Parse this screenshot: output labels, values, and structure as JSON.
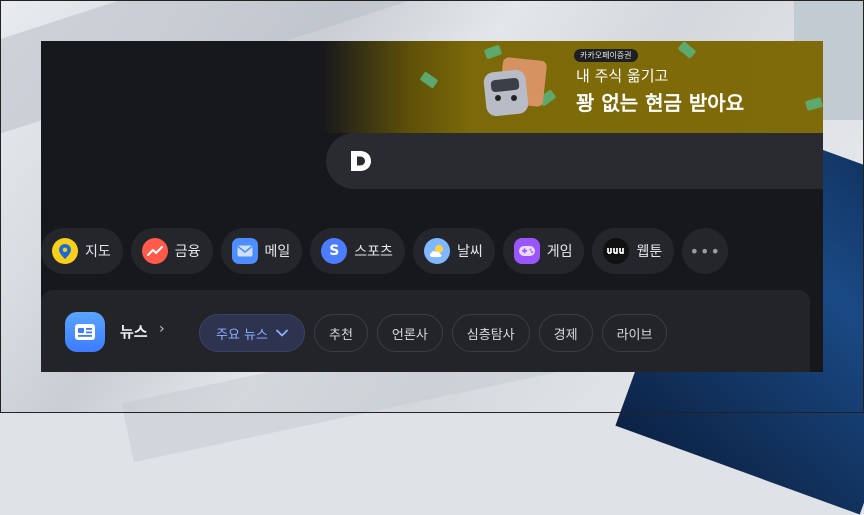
{
  "banner": {
    "tag": "카카오페이증권",
    "line1": "내 주식 옮기고",
    "line2": "꽝 없는 현금 받아요"
  },
  "search": {
    "logo_letter": "D"
  },
  "shortcuts": [
    {
      "label": "지도",
      "icon": "map-pin-icon",
      "color": "#f9cf1a"
    },
    {
      "label": "금융",
      "icon": "chart-trend-icon",
      "color": "#ff5a4a"
    },
    {
      "label": "메일",
      "icon": "mail-icon",
      "color": "#4c8dff"
    },
    {
      "label": "스포츠",
      "icon": "sports-icon",
      "color": "#4c7dff"
    },
    {
      "label": "날씨",
      "icon": "weather-icon",
      "color": "#7fb8ff"
    },
    {
      "label": "게임",
      "icon": "game-controller-icon",
      "color": "#9a55ff"
    },
    {
      "label": "웹툰",
      "icon": "webtoon-icon",
      "color": "#111111"
    }
  ],
  "news": {
    "title": "뉴스",
    "tabs": [
      {
        "label": "주요 뉴스",
        "active": true
      },
      {
        "label": "추천",
        "active": false
      },
      {
        "label": "언론사",
        "active": false
      },
      {
        "label": "심층탐사",
        "active": false
      },
      {
        "label": "경제",
        "active": false
      },
      {
        "label": "라이브",
        "active": false
      }
    ]
  },
  "colors": {
    "window_bg": "#17181c",
    "chip_bg": "#25262b",
    "accent": "#8fb0ff",
    "banner_gold": "#7f6b09"
  }
}
